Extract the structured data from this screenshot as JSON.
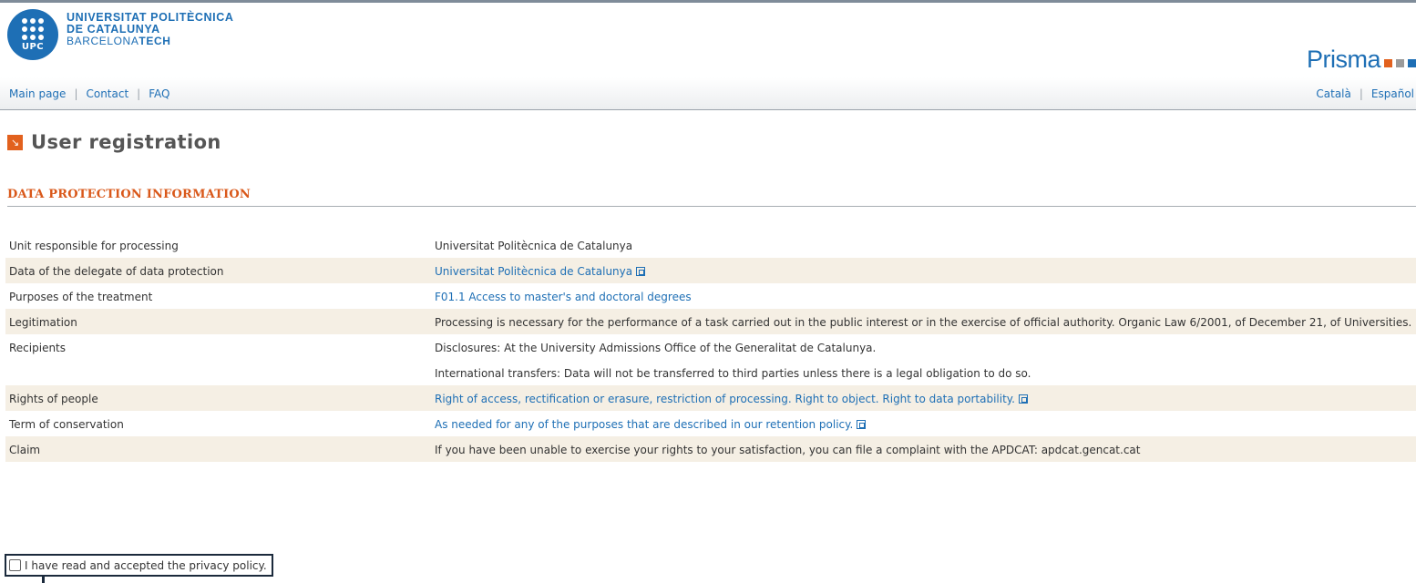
{
  "header": {
    "university_line1": "UNIVERSITAT POLITÈCNICA",
    "university_line2": "DE CATALUNYA",
    "university_line3_a": "BARCELONA",
    "university_line3_b": "TECH",
    "logo_text": "UPC",
    "app_name": "Prisma",
    "logo_color": "#1e6fb5",
    "brand_squares": [
      "#e2611e",
      "#9a9a9a",
      "#1e6fb5"
    ]
  },
  "nav": {
    "main_page": "Main page",
    "contact": "Contact",
    "faq": "FAQ",
    "lang_ca": "Català",
    "lang_es": "Español"
  },
  "page": {
    "title": "User registration",
    "title_icon": "arrow-down-right-icon",
    "section_heading": "DATA PROTECTION INFORMATION"
  },
  "table": {
    "rows": [
      {
        "label": "Unit responsible for processing",
        "value": "Universitat Politècnica de Catalunya"
      },
      {
        "label": "Data of the delegate of data protection",
        "value": "Universitat Politècnica de Catalunya"
      },
      {
        "label": "Purposes of the treatment",
        "value": "F01.1 Access to master's and doctoral degrees"
      },
      {
        "label": "Legitimation",
        "value": "Processing is necessary for the performance of a task carried out in the public interest or in the exercise of official authority. Organic Law 6/2001, of December 21, of Universities."
      },
      {
        "label": "Recipients",
        "value": "Disclosures: At the University Admissions Office of the Generalitat de Catalunya.",
        "value2": "International transfers: Data will not be transferred to third parties unless there is a legal obligation to do so."
      },
      {
        "label": "Rights of people",
        "value": "Right of access, rectification or erasure, restriction of processing. Right to object. Right to data portability."
      },
      {
        "label": "Term of conservation",
        "value": "As needed for any of the purposes that are described in our retention policy."
      },
      {
        "label": "Claim",
        "value": "If you have been unable to exercise your rights to your satisfaction, you can file a complaint with the APDCAT: apdcat.gencat.cat"
      }
    ]
  },
  "consent": {
    "label": "I have read and accepted the privacy policy.",
    "checked": false
  }
}
